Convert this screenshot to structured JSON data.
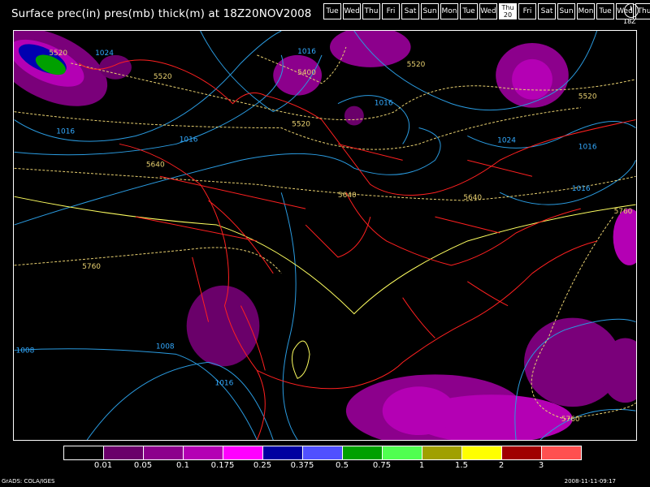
{
  "title": "Surface prec(in) pres(mb) thick(m) at 18Z20NOV2008",
  "days": [
    {
      "label": "Tue",
      "active": false
    },
    {
      "label": "Wed",
      "active": false
    },
    {
      "label": "Thu",
      "active": false
    },
    {
      "label": "Fri",
      "active": false
    },
    {
      "label": "Sat",
      "active": false
    },
    {
      "label": "Sun",
      "active": false
    },
    {
      "label": "Mon",
      "active": false
    },
    {
      "label": "Tue",
      "active": false
    },
    {
      "label": "Wed",
      "active": false
    },
    {
      "label": "Thu",
      "sub": "20",
      "active": true
    },
    {
      "label": "Fri",
      "active": false
    },
    {
      "label": "Sat",
      "active": false
    },
    {
      "label": "Sun",
      "active": false
    },
    {
      "label": "Mon",
      "active": false
    },
    {
      "label": "Tue",
      "active": false
    },
    {
      "label": "Wed",
      "active": false
    },
    {
      "label": "Thu",
      "active": false
    }
  ],
  "clock_label": "18Z",
  "map_labels": {
    "isobars": [
      "1024",
      "1016",
      "1016",
      "1016",
      "1016",
      "1024",
      "1016",
      "1016",
      "1008",
      "1008",
      "1016"
    ],
    "thickness": [
      "5520",
      "5520",
      "5400",
      "5520",
      "5520",
      "5520",
      "5640",
      "5640",
      "5640",
      "5760",
      "5760",
      "5760"
    ]
  },
  "colorbar": {
    "colors": [
      "#000000",
      "#6a006a",
      "#8c008c",
      "#b400b4",
      "#ff00ff",
      "#0000a0",
      "#5050ff",
      "#00a000",
      "#50ff50",
      "#a0a000",
      "#ffff00",
      "#a00000",
      "#ff5050"
    ],
    "ticks": [
      "0.01",
      "0.05",
      "0.1",
      "0.175",
      "0.25",
      "0.375",
      "0.5",
      "0.75",
      "1",
      "1.5",
      "2",
      "3"
    ]
  },
  "footer_left": "GrADS: COLA/IGES",
  "footer_right": "2008-11-11-09:17"
}
